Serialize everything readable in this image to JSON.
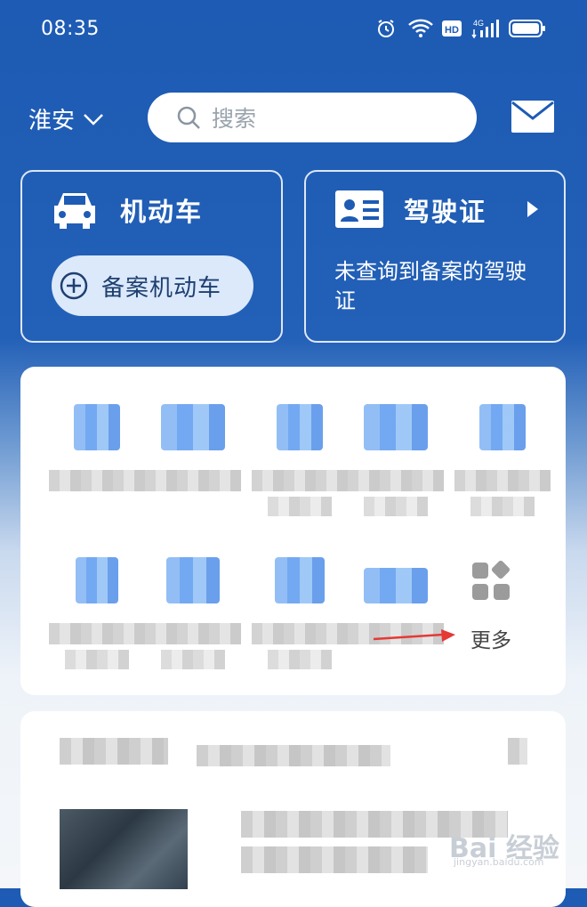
{
  "status_bar": {
    "time": "08:35",
    "network": "4G"
  },
  "header": {
    "city": "淮安",
    "search_placeholder": "搜索"
  },
  "vehicle_card": {
    "title": "机动车",
    "register_button": "备案机动车"
  },
  "license_card": {
    "title": "驾驶证",
    "description": "未查询到备案的驾驶证"
  },
  "services": {
    "more_label": "更多"
  },
  "watermark": {
    "brand": "Bai 经验",
    "url": "jingyan.baidu.com"
  },
  "colors": {
    "primary": "#1d5bb4",
    "button_bg": "#dbe9fb",
    "icon_blue": "#5a9aef"
  }
}
